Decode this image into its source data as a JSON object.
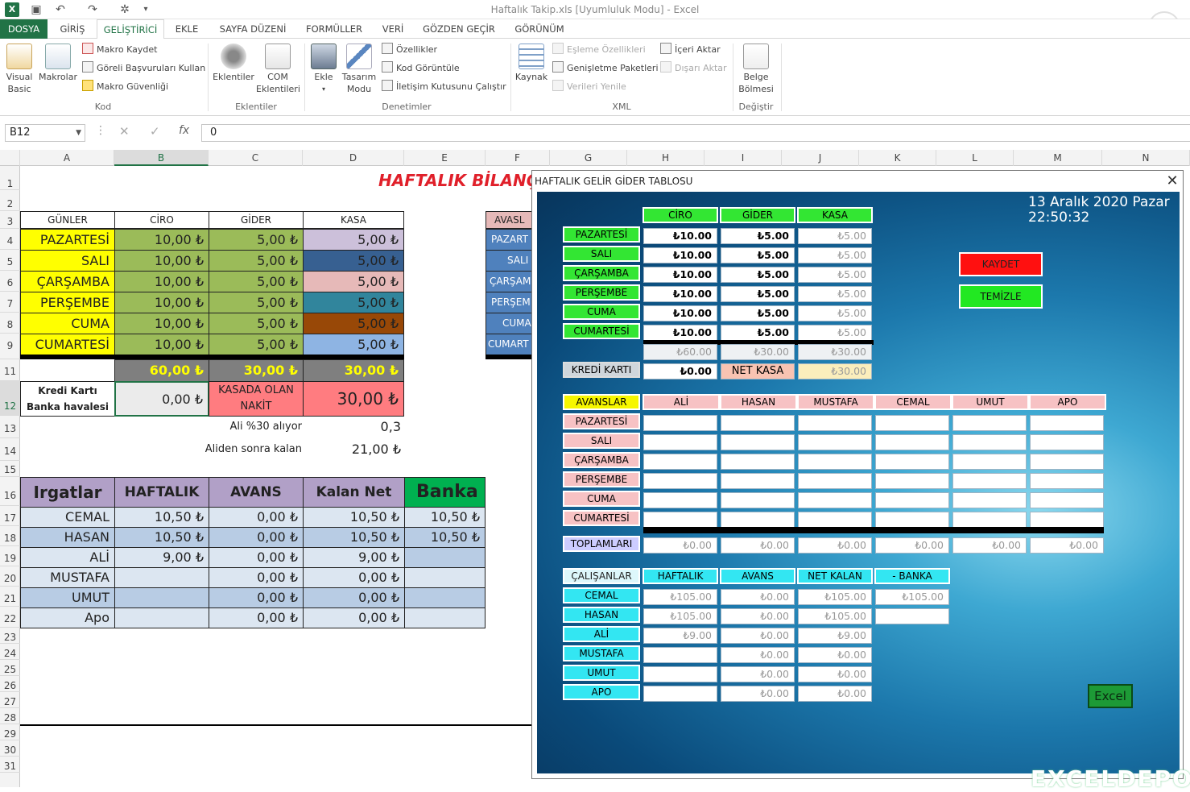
{
  "window": {
    "title": "Haftalık Takip.xls  [Uyumluluk Modu] - Excel"
  },
  "ribbon_tabs": [
    "DOSYA",
    "GİRİŞ",
    "GELİŞTİRİCİ",
    "EKLE",
    "SAYFA DÜZENİ",
    "FORMÜLLER",
    "VERİ",
    "GÖZDEN GEÇİR",
    "GÖRÜNÜM"
  ],
  "ribbon": {
    "visual_basic": "Visual\nBasic",
    "macros": "Makrolar",
    "record_macro": "Makro Kaydet",
    "relative_refs": "Göreli Başvuruları Kullan",
    "macro_security": "Makro Güvenliği",
    "group_code": "Kod",
    "addins": "Eklentiler",
    "com_addins": "COM\nEklentileri",
    "group_addins": "Eklentiler",
    "insert": "Ekle",
    "design_mode": "Tasarım\nModu",
    "properties": "Özellikler",
    "view_code": "Kod Görüntüle",
    "run_dialog": "İletişim Kutusunu Çalıştır",
    "group_controls": "Denetimler",
    "source": "Kaynak",
    "map_properties": "Eşleme Özellikleri",
    "expansion_packs": "Genişletme Paketleri",
    "refresh_data": "Verileri Yenile",
    "import": "İçeri Aktar",
    "export": "Dışarı Aktar",
    "group_xml": "XML",
    "doc_panel": "Belge\nBölmesi",
    "group_modify": "Değiştir"
  },
  "formula_bar": {
    "name_box": "B12",
    "content": "0"
  },
  "columns": [
    "A",
    "B",
    "C",
    "D",
    "E",
    "F",
    "G",
    "H",
    "I",
    "J",
    "K",
    "L",
    "M",
    "N"
  ],
  "rows": [
    "1",
    "2",
    "3",
    "4",
    "5",
    "6",
    "7",
    "8",
    "9",
    "11",
    "12",
    "13",
    "14",
    "15",
    "16",
    "17",
    "18",
    "19",
    "20",
    "21",
    "22",
    "23",
    "24",
    "25",
    "26",
    "27",
    "28",
    "29",
    "30",
    "31"
  ],
  "sheet": {
    "title": "HAFTALIK BİLANÇ",
    "headers": [
      "GÜNLER",
      "CİRO",
      "GİDER",
      "KASA"
    ],
    "days": [
      {
        "name": "PAZARTESİ",
        "ciro": "10,00 ₺",
        "gider": "5,00 ₺",
        "kasa": "5,00 ₺",
        "kasa_color": "#ccc0da"
      },
      {
        "name": "SALI",
        "ciro": "10,00 ₺",
        "gider": "5,00 ₺",
        "kasa": "5,00 ₺",
        "kasa_color": "#376091"
      },
      {
        "name": "ÇARŞAMBA",
        "ciro": "10,00 ₺",
        "gider": "5,00 ₺",
        "kasa": "5,00 ₺",
        "kasa_color": "#e6b9b8"
      },
      {
        "name": "PERŞEMBE",
        "ciro": "10,00 ₺",
        "gider": "5,00 ₺",
        "kasa": "5,00 ₺",
        "kasa_color": "#31859c"
      },
      {
        "name": "CUMA",
        "ciro": "10,00 ₺",
        "gider": "5,00 ₺",
        "kasa": "5,00 ₺",
        "kasa_color": "#984807"
      },
      {
        "name": "CUMARTESİ",
        "ciro": "10,00 ₺",
        "gider": "5,00 ₺",
        "kasa": "5,00 ₺",
        "kasa_color": "#8eb4e3"
      }
    ],
    "totals": {
      "ciro": "60,00 ₺",
      "gider": "30,00 ₺",
      "kasa": "30,00 ₺"
    },
    "kredi_label": "Kredi Kartı\nBanka havalesi",
    "kredi_value": "0,00 ₺",
    "kasada_label": "KASADA OLAN\nNAKİT",
    "kasada_value": "30,00 ₺",
    "ali_rate_label": "Ali %30 alıyor",
    "ali_rate_value": "0,3",
    "after_ali_label": "Aliden sonra kalan",
    "after_ali_value": "21,00 ₺",
    "avans_header": "AVASL",
    "avans_days": [
      "PAZART",
      "SALI",
      "ÇARŞAM",
      "PERŞEM",
      "CUMA",
      "CUMART"
    ],
    "workers_headers": [
      "Irgatlar",
      "HAFTALIK",
      "AVANS",
      "Kalan Net",
      "Banka -"
    ],
    "workers": [
      {
        "name": "CEMAL",
        "haftalik": "10,50 ₺",
        "avans": "0,00 ₺",
        "kalan": "10,50 ₺",
        "banka": "10,50 ₺"
      },
      {
        "name": "HASAN",
        "haftalik": "10,50 ₺",
        "avans": "0,00 ₺",
        "kalan": "10,50 ₺",
        "banka": "10,50 ₺"
      },
      {
        "name": "ALİ",
        "haftalik": "9,00 ₺",
        "avans": "0,00 ₺",
        "kalan": "9,00 ₺",
        "banka": ""
      },
      {
        "name": "MUSTAFA",
        "haftalik": "",
        "avans": "0,00 ₺",
        "kalan": "0,00 ₺",
        "banka": ""
      },
      {
        "name": "UMUT",
        "haftalik": "",
        "avans": "0,00 ₺",
        "kalan": "0,00 ₺",
        "banka": ""
      },
      {
        "name": "Apo",
        "haftalik": "",
        "avans": "0,00 ₺",
        "kalan": "0,00 ₺",
        "banka": ""
      }
    ]
  },
  "form": {
    "title": "HAFTALIK GELİR GİDER TABLOSU",
    "date": "13 Aralık 2020 Pazar",
    "time": "22:50:32",
    "top_headers": [
      "CİRO",
      "GİDER",
      "KASA"
    ],
    "days": [
      "PAZARTESİ",
      "SALI",
      "ÇARŞAMBA",
      "PERŞEMBE",
      "CUMA",
      "CUMARTESİ"
    ],
    "ciro": [
      "₺10.00",
      "₺10.00",
      "₺10.00",
      "₺10.00",
      "₺10.00",
      "₺10.00"
    ],
    "gider": [
      "₺5.00",
      "₺5.00",
      "₺5.00",
      "₺5.00",
      "₺5.00",
      "₺5.00"
    ],
    "kasa": [
      "₺5.00",
      "₺5.00",
      "₺5.00",
      "₺5.00",
      "₺5.00",
      "₺5.00"
    ],
    "totals": [
      "₺60.00",
      "₺30.00",
      "₺30.00"
    ],
    "kredi_label": "KREDİ KARTI",
    "kredi_value": "₺0.00",
    "net_kasa_label": "NET KASA",
    "net_kasa_value": "₺30.00",
    "kaydet": "KAYDET",
    "temizle": "TEMİZLE",
    "avans_label": "AVANSLAR",
    "avans_names": [
      "ALİ",
      "HASAN",
      "MUSTAFA",
      "CEMAL",
      "UMUT",
      "APO"
    ],
    "toplam_label": "TOPLAMLARI",
    "toplam_values": [
      "₺0.00",
      "₺0.00",
      "₺0.00",
      "₺0.00",
      "₺0.00",
      "₺0.00"
    ],
    "workers_label": "ÇALIŞANLAR",
    "workers_headers": [
      "HAFTALIK",
      "AVANS",
      "NET KALAN",
      "- BANKA"
    ],
    "workers": [
      {
        "name": "CEMAL",
        "haftalik": "₺105.00",
        "avans": "₺0.00",
        "net": "₺105.00",
        "banka": "₺105.00"
      },
      {
        "name": "HASAN",
        "haftalik": "₺105.00",
        "avans": "₺0.00",
        "net": "₺105.00",
        "banka": ""
      },
      {
        "name": "ALİ",
        "haftalik": "₺9.00",
        "avans": "₺0.00",
        "net": "₺9.00"
      },
      {
        "name": "MUSTAFA",
        "haftalik": "",
        "avans": "₺0.00",
        "net": "₺0.00"
      },
      {
        "name": "UMUT",
        "haftalik": "",
        "avans": "₺0.00",
        "net": "₺0.00"
      },
      {
        "name": "APO",
        "haftalik": "",
        "avans": "₺0.00",
        "net": "₺0.00"
      }
    ],
    "excel_button": "Excel"
  },
  "watermark": "EXCELDEPO"
}
